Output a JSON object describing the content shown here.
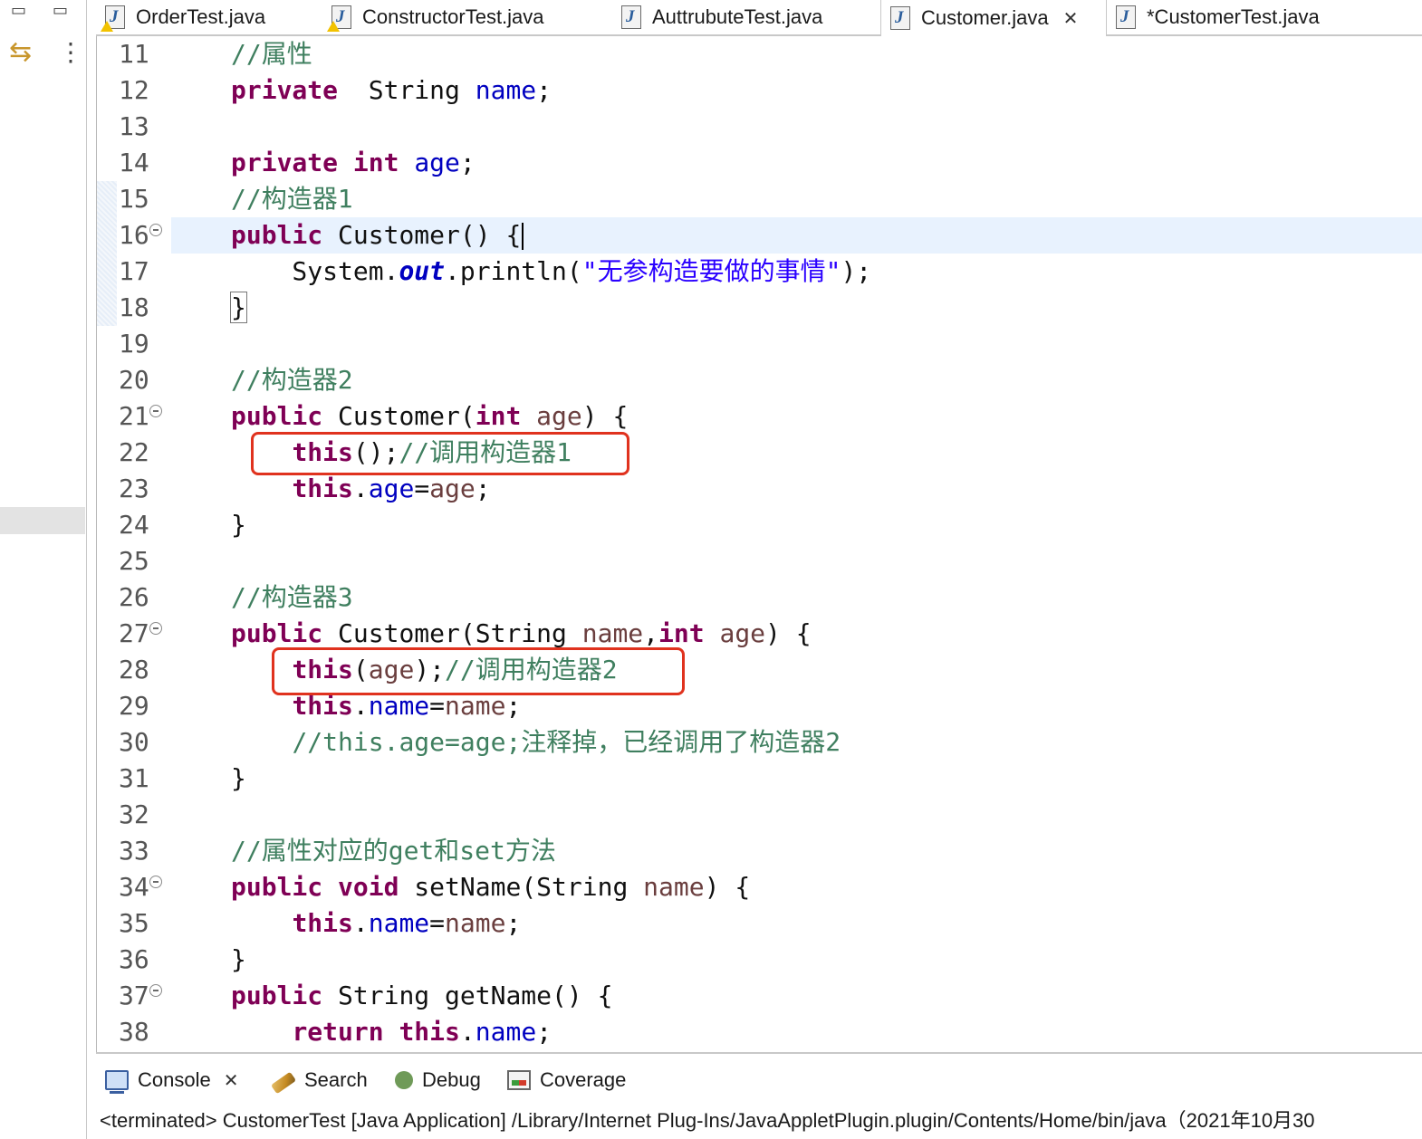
{
  "left_trim": {
    "minimize_glyph": "▭",
    "maximize_glyph": "▭",
    "sync_glyph": "⇆",
    "menu_glyph": "⋮"
  },
  "tabs": [
    {
      "label": "OrderTest.java",
      "warn": true
    },
    {
      "label": "ConstructorTest.java",
      "warn": true
    },
    {
      "label": "AuttrubuteTest.java",
      "warn": false
    },
    {
      "label": "Customer.java",
      "warn": false,
      "active": true,
      "close": "✕"
    },
    {
      "label": "*CustomerTest.java",
      "warn": false
    }
  ],
  "editor": {
    "current_line": 16,
    "lines": [
      {
        "n": "11",
        "tokens": [
          [
            "cm",
            "//属性"
          ]
        ]
      },
      {
        "n": "12",
        "tokens": [
          [
            "kw",
            "private"
          ],
          [
            "",
            "  String "
          ],
          [
            "fld",
            "name"
          ],
          [
            "",
            ";"
          ]
        ]
      },
      {
        "n": "13",
        "tokens": []
      },
      {
        "n": "14",
        "tokens": [
          [
            "kw",
            "private"
          ],
          [
            "",
            " "
          ],
          [
            "kw",
            "int"
          ],
          [
            "",
            " "
          ],
          [
            "fld",
            "age"
          ],
          [
            "",
            ";"
          ]
        ]
      },
      {
        "n": "15",
        "tokens": [
          [
            "cm",
            "//构造器1"
          ]
        ]
      },
      {
        "n": "16",
        "fold": true,
        "tokens": [
          [
            "kw",
            "public"
          ],
          [
            "",
            " Customer() {"
          ]
        ]
      },
      {
        "n": "17",
        "tokens": [
          [
            "",
            "    System."
          ],
          [
            "sfld",
            "out"
          ],
          [
            "",
            ".println("
          ],
          [
            "str",
            "\"无参构造要做的事情\""
          ],
          [
            "",
            ");"
          ]
        ]
      },
      {
        "n": "18",
        "tokens": [
          [
            "bmatch",
            "}"
          ]
        ]
      },
      {
        "n": "19",
        "tokens": []
      },
      {
        "n": "20",
        "tokens": [
          [
            "cm",
            "//构造器2"
          ]
        ]
      },
      {
        "n": "21",
        "fold": true,
        "tokens": [
          [
            "kw",
            "public"
          ],
          [
            "",
            " Customer("
          ],
          [
            "kw",
            "int"
          ],
          [
            "",
            " "
          ],
          [
            "prm",
            "age"
          ],
          [
            "",
            ") {"
          ]
        ]
      },
      {
        "n": "22",
        "tokens": [
          [
            "",
            "    "
          ],
          [
            "kw",
            "this"
          ],
          [
            "",
            "();"
          ],
          [
            "cm",
            "//调用构造器1"
          ]
        ]
      },
      {
        "n": "23",
        "tokens": [
          [
            "",
            "    "
          ],
          [
            "kw",
            "this"
          ],
          [
            "",
            "."
          ],
          [
            "fld",
            "age"
          ],
          [
            "",
            "="
          ],
          [
            "prm",
            "age"
          ],
          [
            "",
            ";"
          ]
        ]
      },
      {
        "n": "24",
        "tokens": [
          [
            "",
            "}"
          ]
        ]
      },
      {
        "n": "25",
        "tokens": []
      },
      {
        "n": "26",
        "tokens": [
          [
            "cm",
            "//构造器3"
          ]
        ]
      },
      {
        "n": "27",
        "fold": true,
        "tokens": [
          [
            "kw",
            "public"
          ],
          [
            "",
            " Customer(String "
          ],
          [
            "prm",
            "name"
          ],
          [
            "",
            ","
          ],
          [
            "kw",
            "int"
          ],
          [
            "",
            " "
          ],
          [
            "prm",
            "age"
          ],
          [
            "",
            ") {"
          ]
        ]
      },
      {
        "n": "28",
        "tokens": [
          [
            "",
            "    "
          ],
          [
            "kw",
            "this"
          ],
          [
            "",
            "("
          ],
          [
            "prm",
            "age"
          ],
          [
            "",
            ");"
          ],
          [
            "cm",
            "//调用构造器2"
          ]
        ]
      },
      {
        "n": "29",
        "tokens": [
          [
            "",
            "    "
          ],
          [
            "kw",
            "this"
          ],
          [
            "",
            "."
          ],
          [
            "fld",
            "name"
          ],
          [
            "",
            "="
          ],
          [
            "prm",
            "name"
          ],
          [
            "",
            ";"
          ]
        ]
      },
      {
        "n": "30",
        "tokens": [
          [
            "",
            "    "
          ],
          [
            "cm",
            "//this.age=age;注释掉，已经调用了构造器2"
          ]
        ]
      },
      {
        "n": "31",
        "tokens": [
          [
            "",
            "}"
          ]
        ]
      },
      {
        "n": "32",
        "tokens": []
      },
      {
        "n": "33",
        "tokens": [
          [
            "cm",
            "//属性对应的get和set方法"
          ]
        ]
      },
      {
        "n": "34",
        "fold": true,
        "tokens": [
          [
            "kw",
            "public"
          ],
          [
            "",
            " "
          ],
          [
            "kw",
            "void"
          ],
          [
            "",
            " setName(String "
          ],
          [
            "prm",
            "name"
          ],
          [
            "",
            ") {"
          ]
        ]
      },
      {
        "n": "35",
        "tokens": [
          [
            "",
            "    "
          ],
          [
            "kw",
            "this"
          ],
          [
            "",
            "."
          ],
          [
            "fld",
            "name"
          ],
          [
            "",
            "="
          ],
          [
            "prm",
            "name"
          ],
          [
            "",
            ";"
          ]
        ]
      },
      {
        "n": "36",
        "tokens": [
          [
            "",
            "}"
          ]
        ]
      },
      {
        "n": "37",
        "fold": true,
        "tokens": [
          [
            "kw",
            "public"
          ],
          [
            "",
            " String getName() {"
          ]
        ]
      },
      {
        "n": "38",
        "tokens": [
          [
            "",
            "    "
          ],
          [
            "kw",
            "return"
          ],
          [
            "",
            " "
          ],
          [
            "kw",
            "this"
          ],
          [
            "",
            "."
          ],
          [
            "fld",
            "name"
          ],
          [
            "",
            ";"
          ]
        ]
      }
    ]
  },
  "console": {
    "tabs": [
      {
        "label": "Console",
        "icon": "console-icon",
        "close": "✕"
      },
      {
        "label": "Search",
        "icon": "search-icon"
      },
      {
        "label": "Debug",
        "icon": "debug-icon"
      },
      {
        "label": "Coverage",
        "icon": "coverage-icon"
      }
    ],
    "status": "<terminated> CustomerTest [Java Application] /Library/Internet Plug-Ins/JavaAppletPlugin.plugin/Contents/Home/bin/java（2021年10月30"
  }
}
